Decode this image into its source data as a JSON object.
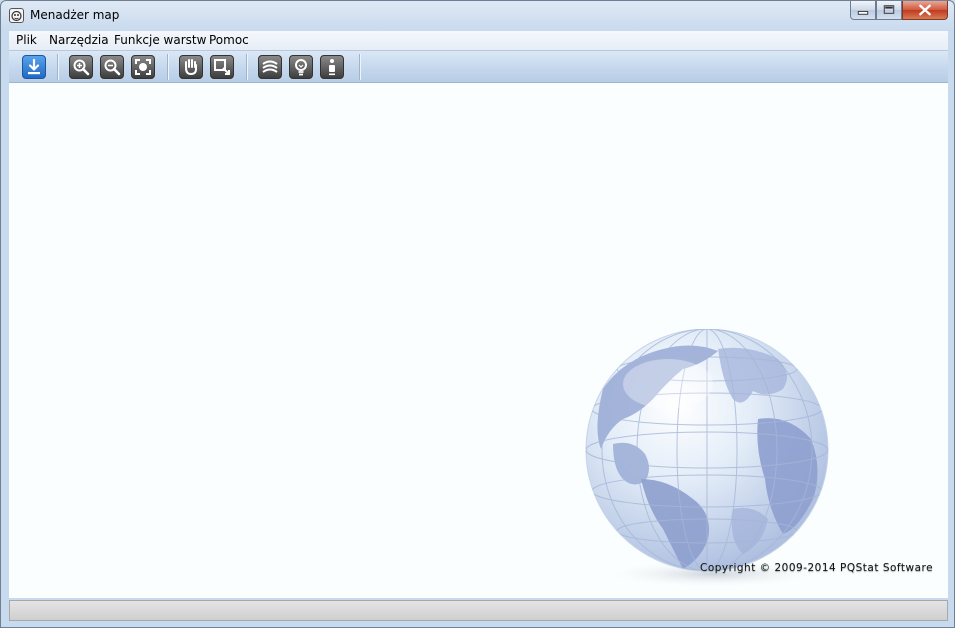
{
  "window": {
    "title": "Menadżer map",
    "icon": "app-icon",
    "caption_buttons": [
      "minimize-icon",
      "maximize-icon",
      "close-icon"
    ]
  },
  "menubar": {
    "items": [
      {
        "label": "Plik"
      },
      {
        "label": "Narzędzia"
      },
      {
        "label": "Funkcje warstw"
      },
      {
        "label": "Pomoc"
      }
    ]
  },
  "toolbar": {
    "buttons": [
      {
        "icon": "download-icon",
        "color": "#2a78d0"
      },
      {
        "icon": "zoom-in-icon",
        "color": "#555555"
      },
      {
        "icon": "zoom-out-icon",
        "color": "#555555"
      },
      {
        "icon": "zoom-extent-icon",
        "color": "#555555"
      },
      {
        "icon": "pan-hand-icon",
        "color": "#555555"
      },
      {
        "icon": "select-rect-icon",
        "color": "#555555"
      },
      {
        "icon": "layers-icon",
        "color": "#555555"
      },
      {
        "icon": "lightbulb-icon",
        "color": "#555555"
      },
      {
        "icon": "info-icon",
        "color": "#555555"
      }
    ]
  },
  "canvas": {
    "background": "#fbfefe",
    "watermark": "globe-icon",
    "copyright": "Copyright © 2009-2014  PQStat Software"
  },
  "statusbar": {}
}
